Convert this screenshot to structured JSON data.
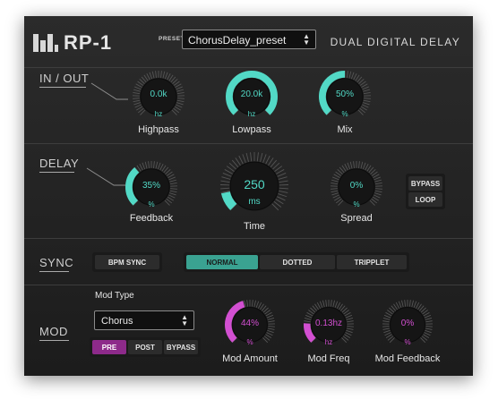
{
  "header": {
    "logo_text": "RP-1",
    "preset_label": "PRESET",
    "preset_value": "ChorusDelay_preset",
    "title": "DUAL DIGITAL DELAY"
  },
  "sections": {
    "in_out": "IN / OUT",
    "delay": "DELAY",
    "sync": "SYNC",
    "mod": "MOD"
  },
  "knobs": {
    "highpass": {
      "value": "0.0k",
      "unit": "hz",
      "label": "Highpass",
      "fill": 0.0
    },
    "lowpass": {
      "value": "20.0k",
      "unit": "hz",
      "label": "Lowpass",
      "fill": 1.0
    },
    "mix": {
      "value": "50%",
      "unit": "%",
      "label": "Mix",
      "fill": 0.5
    },
    "feedback": {
      "value": "35%",
      "unit": "%",
      "label": "Feedback",
      "fill": 0.35
    },
    "time": {
      "value": "250",
      "unit": "ms",
      "label": "Time",
      "fill": 0.12
    },
    "spread": {
      "value": "0%",
      "unit": "%",
      "label": "Spread",
      "fill": 0.0
    },
    "mod_amount": {
      "value": "44%",
      "unit": "%",
      "label": "Mod Amount",
      "fill": 0.44
    },
    "mod_freq": {
      "value": "0.13hz",
      "unit": "hz",
      "label": "Mod Freq",
      "fill": 0.18
    },
    "mod_feedback": {
      "value": "0%",
      "unit": "%",
      "label": "Mod Feedback",
      "fill": 0.0
    }
  },
  "delay_buttons": {
    "bypass": "BYPASS",
    "loop": "LOOP"
  },
  "sync": {
    "bpm_sync": "BPM SYNC",
    "normal": "NORMAL",
    "dotted": "DOTTED",
    "tripplet": "TRIPPLET",
    "selected": "NORMAL"
  },
  "mod": {
    "type_label": "Mod Type",
    "type_value": "Chorus",
    "pre": "PRE",
    "post": "POST",
    "bypass": "BYPASS",
    "selected": "PRE"
  },
  "colors": {
    "teal": "#52d9c6",
    "magenta": "#d24fd1",
    "panel": "#232323"
  }
}
